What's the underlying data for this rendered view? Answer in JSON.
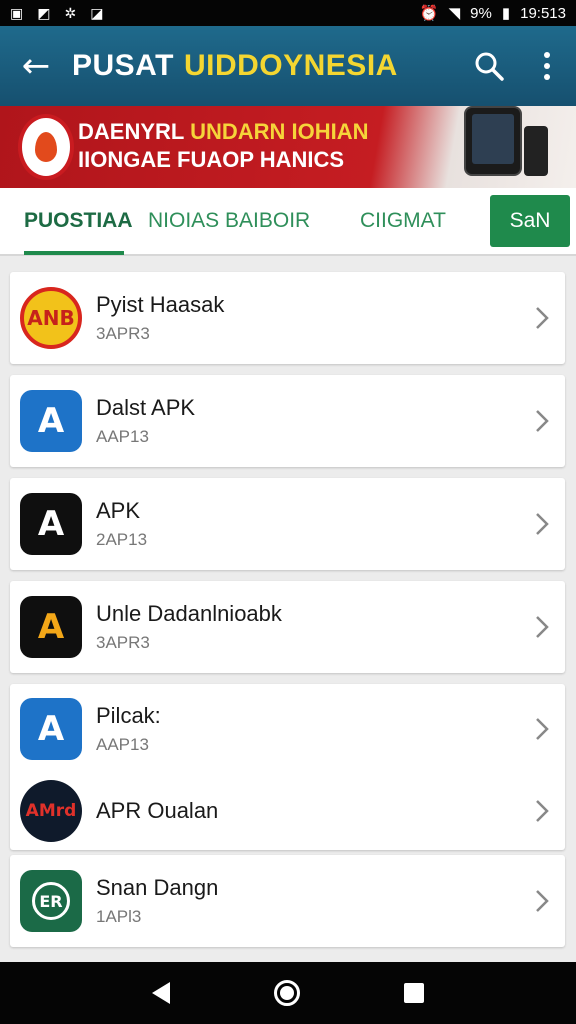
{
  "status_bar": {
    "battery": "9%",
    "time": "19:513"
  },
  "app_bar": {
    "title_part1": "PUSAT",
    "title_part2": "UIDDOYNESIA"
  },
  "banner": {
    "line1_white": "DAENYRL",
    "line1_yellow": "UNDARN IOHIAN",
    "line2": "IIONGAE FUAOP HANICS"
  },
  "tabs": [
    {
      "label": "PUOSTIAA",
      "active": true
    },
    {
      "label": "NIOIAS BAIBOIR",
      "active": false
    },
    {
      "label": "CIIGMAT",
      "active": false
    }
  ],
  "scan_button": "SaN",
  "apps": [
    {
      "name": "Pyist Haasak",
      "sub": "3APR3",
      "icon_text": "ANB",
      "icon": "anb-logo-icon"
    },
    {
      "name": "Dalst APK",
      "sub": "AAP13",
      "icon_text": "A",
      "icon": "blue-a-icon"
    },
    {
      "name": "APK",
      "sub": "2AP13",
      "icon_text": "A",
      "icon": "black-a-icon"
    },
    {
      "name": "Unle Dadanlnioabk",
      "sub": "3APR3",
      "icon_text": "A",
      "icon": "gold-a-icon"
    },
    {
      "name": "Pilcak:",
      "sub": "AAP13",
      "icon_text": "A",
      "icon": "blue-a-icon"
    },
    {
      "name": "APR Oualan",
      "sub": "",
      "icon_text": "AMrd",
      "icon": "amrd-logo-icon"
    },
    {
      "name": "Snan Dangn",
      "sub": "1APl3",
      "icon_text": "ER",
      "icon": "green-er-icon"
    }
  ],
  "colors": {
    "app_bar": "#1f6a8c",
    "accent_green": "#1f8a4c",
    "title_yellow": "#f4d631",
    "banner_red": "#c51d22"
  }
}
